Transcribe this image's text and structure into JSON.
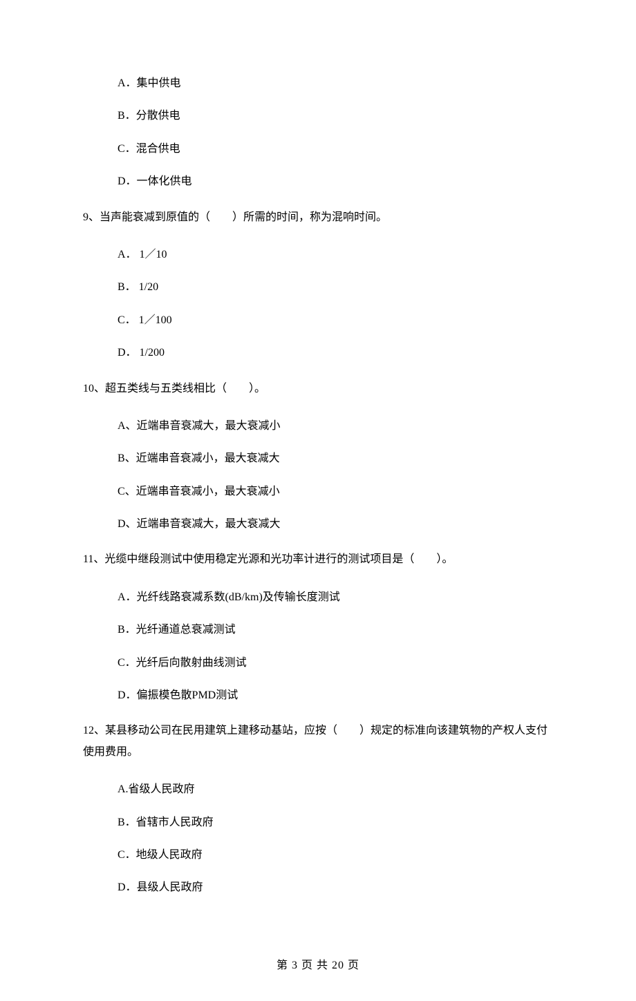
{
  "q8": {
    "options": {
      "a": "A．集中供电",
      "b": "B．分散供电",
      "c": "C．混合供电",
      "d": "D．一体化供电"
    }
  },
  "q9": {
    "stem": "9、当声能衰减到原值的（　　）所需的时间，称为混响时间。",
    "options": {
      "a": "A．  1／10",
      "b": "B．  1/20",
      "c": "C．  1／100",
      "d": "D．  1/200"
    }
  },
  "q10": {
    "stem": "10、超五类线与五类线相比（　　）。",
    "options": {
      "a": "A、近端串音衰减大，最大衰减小",
      "b": "B、近端串音衰减小，最大衰减大",
      "c": "C、近端串音衰减小，最大衰减小",
      "d": "D、近端串音衰减大，最大衰减大"
    }
  },
  "q11": {
    "stem": "11、光缆中继段测试中使用稳定光源和光功率计进行的测试项目是（　　）。",
    "options": {
      "a": "A．光纤线路衰减系数(dB/km)及传输长度测试",
      "b": "B．光纤通道总衰减测试",
      "c": "C．光纤后向散射曲线测试",
      "d": "D．偏振模色散PMD测试"
    }
  },
  "q12": {
    "stem": "12、某县移动公司在民用建筑上建移动基站，应按（　　）规定的标准向该建筑物的产权人支付使用费用。",
    "options": {
      "a": "A.省级人民政府",
      "b": "B．省辖市人民政府",
      "c": "C．地级人民政府",
      "d": "D．县级人民政府"
    }
  },
  "footer": "第 3 页 共 20 页"
}
